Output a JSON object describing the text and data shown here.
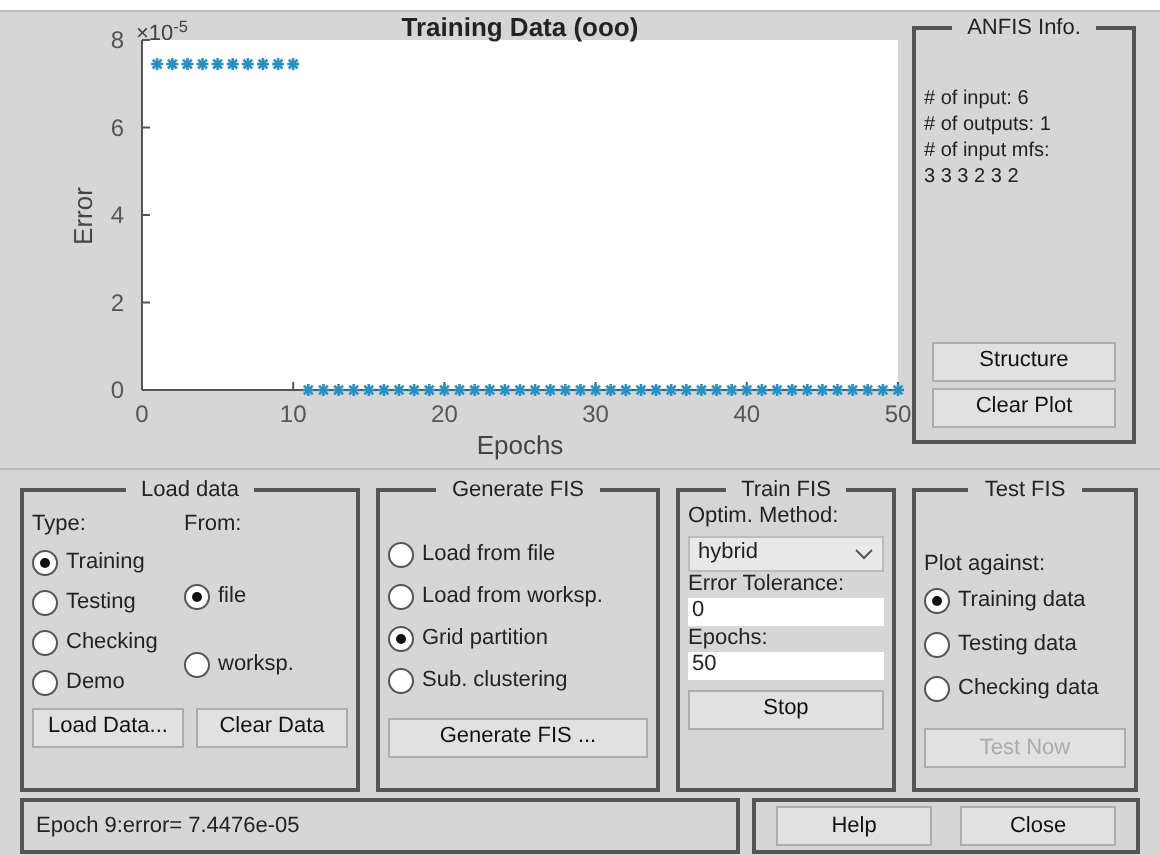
{
  "plot": {
    "chart_data": {
      "type": "scatter",
      "title": "Training Data (ooo)",
      "xlabel": "Epochs",
      "ylabel": "Error",
      "x": [
        1,
        2,
        3,
        4,
        5,
        6,
        7,
        8,
        9,
        10,
        11,
        12,
        13,
        14,
        15,
        16,
        17,
        18,
        19,
        20,
        21,
        22,
        23,
        24,
        25,
        26,
        27,
        28,
        29,
        30,
        31,
        32,
        33,
        34,
        35,
        36,
        37,
        38,
        39,
        40,
        41,
        42,
        43,
        44,
        45,
        46,
        47,
        48,
        49,
        50
      ],
      "series": [
        {
          "color": "#2a8fc0",
          "values": [
            7.45,
            7.45,
            7.45,
            7.45,
            7.45,
            7.45,
            7.45,
            7.45,
            7.45,
            7.45,
            0,
            0,
            0,
            0,
            0,
            0,
            0,
            0,
            0,
            0,
            0,
            0,
            0,
            0,
            0,
            0,
            0,
            0,
            0,
            0,
            0,
            0,
            0,
            0,
            0,
            0,
            0,
            0,
            0,
            0,
            0,
            0,
            0,
            0,
            0,
            0,
            0,
            0,
            0,
            0
          ]
        }
      ],
      "xlim": [
        0,
        50
      ],
      "ylim": [
        0,
        8
      ],
      "xticks": [
        0,
        10,
        20,
        30,
        40,
        50
      ],
      "yticks": [
        0,
        2,
        4,
        6,
        8
      ],
      "annotations": [
        "×10$^{-5}$"
      ]
    }
  },
  "anfis_info": {
    "title": "ANFIS Info.",
    "lines": [
      "# of input: 6",
      "# of outputs: 1",
      "# of input mfs:",
      "3 3 3 2 3 2"
    ],
    "buttons": [
      "Structure",
      "Clear Plot"
    ]
  },
  "load_data": {
    "title": "Load data",
    "type_label": "Type:",
    "from_label": "From:",
    "types": [
      {
        "label": "Training",
        "selected": true
      },
      {
        "label": "Testing",
        "selected": false
      },
      {
        "label": "Checking",
        "selected": false
      },
      {
        "label": "Demo",
        "selected": false
      }
    ],
    "sources": [
      {
        "label": "file",
        "selected": true
      },
      {
        "label": "worksp.",
        "selected": false
      }
    ],
    "buttons": [
      "Load Data...",
      "Clear Data"
    ]
  },
  "generate_fis": {
    "title": "Generate FIS",
    "options": [
      {
        "label": "Load from file",
        "selected": false
      },
      {
        "label": "Load from worksp.",
        "selected": false
      },
      {
        "label": "Grid partition",
        "selected": true
      },
      {
        "label": "Sub. clustering",
        "selected": false
      }
    ],
    "button": "Generate FIS ..."
  },
  "train_fis": {
    "title": "Train FIS",
    "method_label": "Optim. Method:",
    "method": "hybrid",
    "tolerance_label": "Error Tolerance:",
    "tolerance": "0",
    "epochs_label": "Epochs:",
    "epochs": "50",
    "button": "Stop"
  },
  "test_fis": {
    "title": "Test FIS",
    "plot_against_label": "Plot against:",
    "options": [
      {
        "label": "Training data",
        "selected": true
      },
      {
        "label": "Testing data",
        "selected": false
      },
      {
        "label": "Checking data",
        "selected": false
      }
    ],
    "button": {
      "label": "Test Now",
      "disabled": true
    }
  },
  "status": "Epoch 9:error= 7.4476e-05",
  "buttons": [
    "Help",
    "Close"
  ]
}
